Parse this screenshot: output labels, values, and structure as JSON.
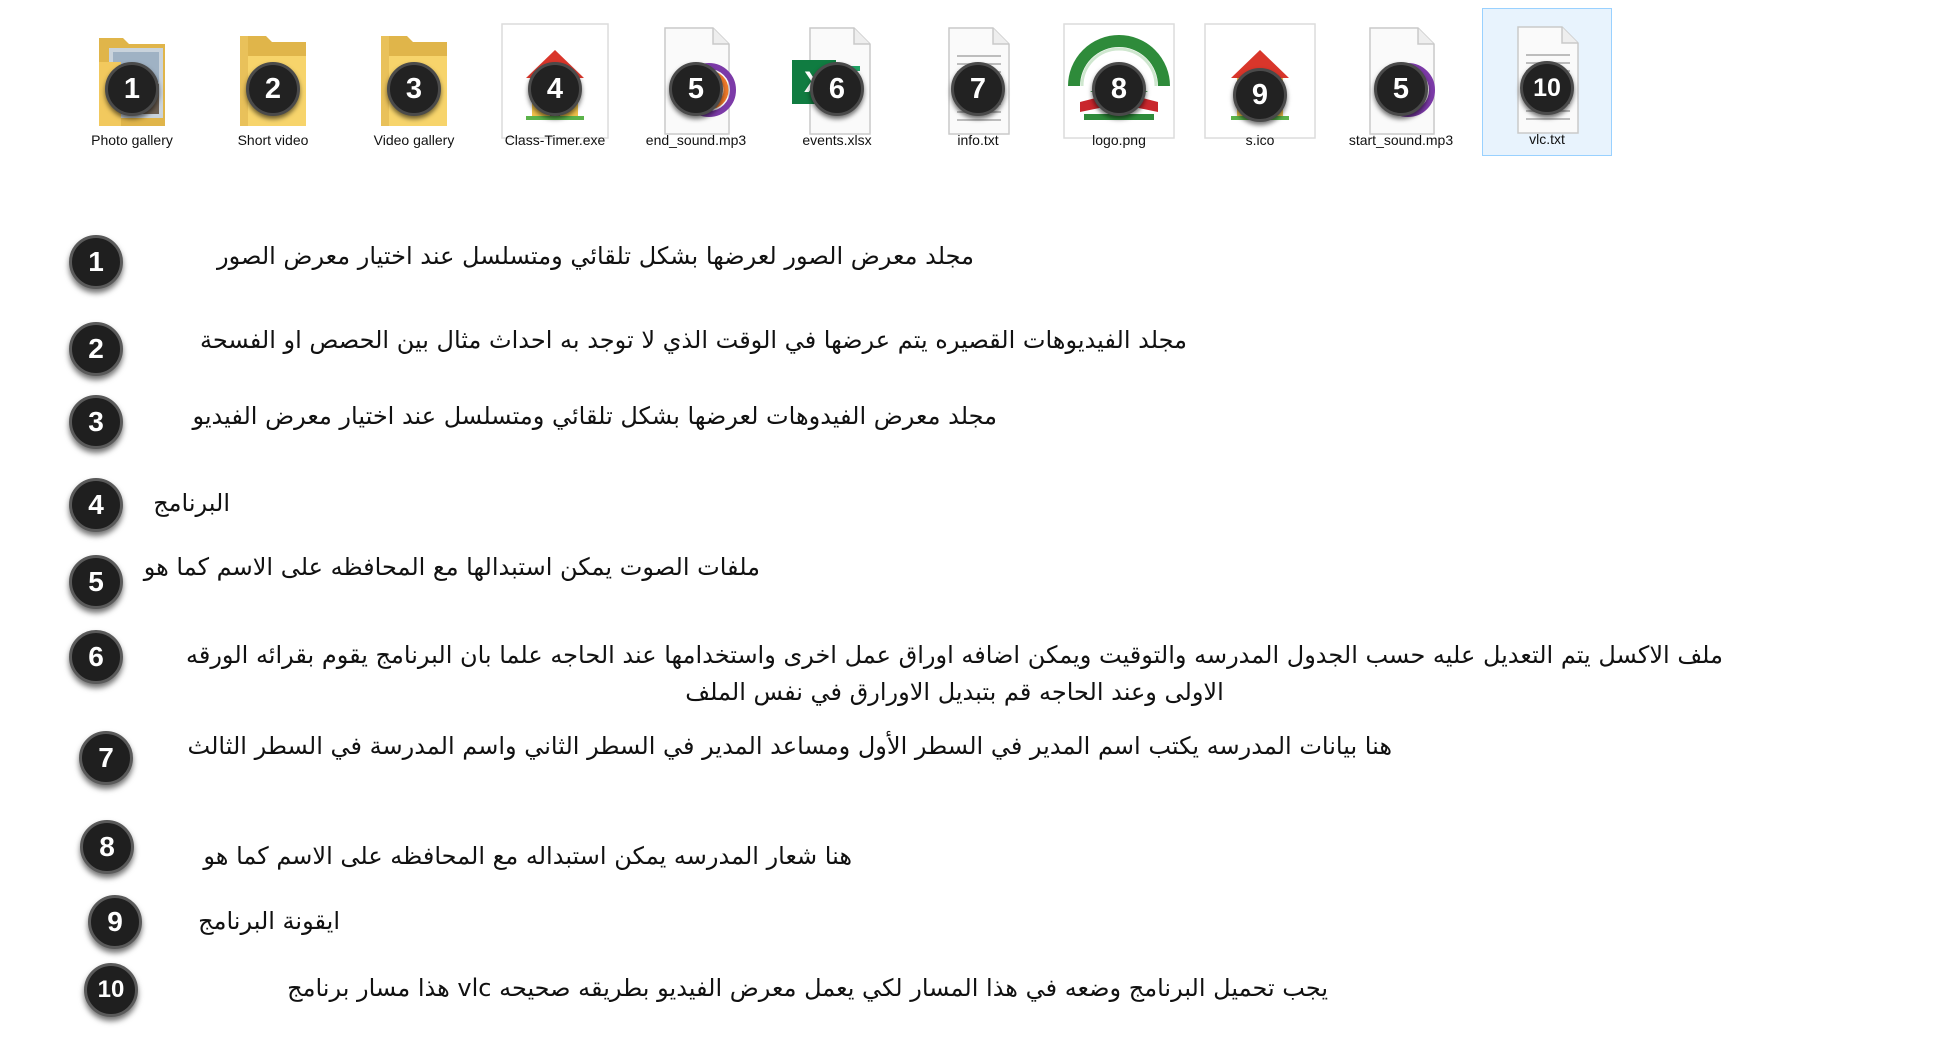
{
  "files": [
    {
      "name": "Photo gallery",
      "badge": "1",
      "icon": "folder-with-photo-icon"
    },
    {
      "name": "Short video",
      "badge": "2",
      "icon": "folder-icon"
    },
    {
      "name": "Video gallery",
      "badge": "3",
      "icon": "folder-icon"
    },
    {
      "name": "Class-Timer.exe",
      "badge": "4",
      "icon": "school-house-app-icon"
    },
    {
      "name": "end_sound.mp3",
      "badge": "5",
      "icon": "audio-file-icon"
    },
    {
      "name": "events.xlsx",
      "badge": "6",
      "icon": "excel-file-icon"
    },
    {
      "name": "info.txt",
      "badge": "7",
      "icon": "text-file-icon"
    },
    {
      "name": "logo.png",
      "badge": "8",
      "icon": "school-logo-image-icon"
    },
    {
      "name": "s.ico",
      "badge": "9",
      "icon": "school-house-icon"
    },
    {
      "name": "start_sound.mp3",
      "badge": "5",
      "icon": "audio-file-icon"
    },
    {
      "name": "vlc.txt",
      "badge": "10",
      "icon": "text-file-icon",
      "selected": true
    }
  ],
  "legend": [
    {
      "badge": "1",
      "text": "مجلد معرض الصور لعرضها بشكل تلقائي ومتسلسل عند اختيار معرض الصور"
    },
    {
      "badge": "2",
      "text": "مجلد الفيديوهات القصيره يتم عرضها في الوقت الذي لا توجد به احداث مثال بين الحصص او الفسحة"
    },
    {
      "badge": "3",
      "text": "مجلد معرض الفيدوهات لعرضها بشكل تلقائي ومتسلسل عند اختيار معرض الفيديو"
    },
    {
      "badge": "4",
      "text": "البرنامج"
    },
    {
      "badge": "5",
      "text": "ملفات الصوت يمكن استبدالها مع المحافظه على الاسم كما هو"
    },
    {
      "badge": "6",
      "text": "ملف الاكسل يتم التعديل عليه حسب الجدول المدرسه والتوقيت ويمكن اضافه اوراق عمل اخرى واستخدامها عند الحاجه علما بان البرنامج يقوم بقرائه الورقه",
      "text2": "الاولى وعند الحاجه قم بتبديل الاورارق في نفس الملف"
    },
    {
      "badge": "7",
      "text": "هنا بيانات المدرسه يكتب اسم المدير في السطر الأول ومساعد المدير في السطر الثاني واسم المدرسة في السطر الثالث"
    },
    {
      "badge": "8",
      "text": "هنا شعار المدرسه يمكن استبداله مع المحافظه على الاسم كما هو"
    },
    {
      "badge": "9",
      "text": "ايقونة البرنامج"
    },
    {
      "badge": "10",
      "text": "يجب تحميل البرنامج  وضعه في هذا المسار لكي يعمل معرض الفيديو بطريقه صحيحه     vlc هذا مسار برنامج"
    }
  ]
}
